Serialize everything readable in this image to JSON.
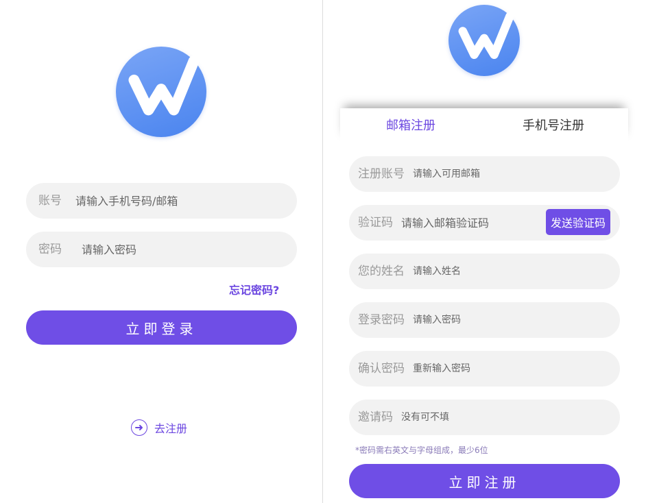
{
  "theme": {
    "accent": "#6f4ee6",
    "field_bg": "#f2f2f2",
    "logo_gradient": [
      "#7aa5f6",
      "#4a84ef"
    ]
  },
  "login": {
    "logo_icon": "w-logo-icon",
    "account": {
      "label": "账号",
      "placeholder": "请输入手机号码/邮箱"
    },
    "password": {
      "label": "密码",
      "placeholder": "请输入密码"
    },
    "forgot_label": "忘记密码?",
    "submit_label": "立即登录",
    "register_link": {
      "icon": "circle-arrow-right-icon",
      "label": "去注册"
    }
  },
  "register": {
    "logo_icon": "w-logo-icon",
    "tabs": [
      {
        "label": "邮箱注册",
        "active": true
      },
      {
        "label": "手机号注册",
        "active": false
      }
    ],
    "fields": {
      "account": {
        "label": "注册账号",
        "placeholder": "请输入可用邮箱"
      },
      "code": {
        "label": "验证码",
        "placeholder": "请输入邮箱验证码",
        "send_label": "发送验证码"
      },
      "name": {
        "label": "您的姓名",
        "placeholder": "请输入姓名"
      },
      "password": {
        "label": "登录密码",
        "placeholder": "请输入密码"
      },
      "confirm": {
        "label": "确认密码",
        "placeholder": "重新输入密码"
      },
      "invite": {
        "label": "邀请码",
        "placeholder": "没有可不填"
      }
    },
    "hint": "*密码需右英文与字母组成，最少6位",
    "submit_label": "立即注册"
  }
}
